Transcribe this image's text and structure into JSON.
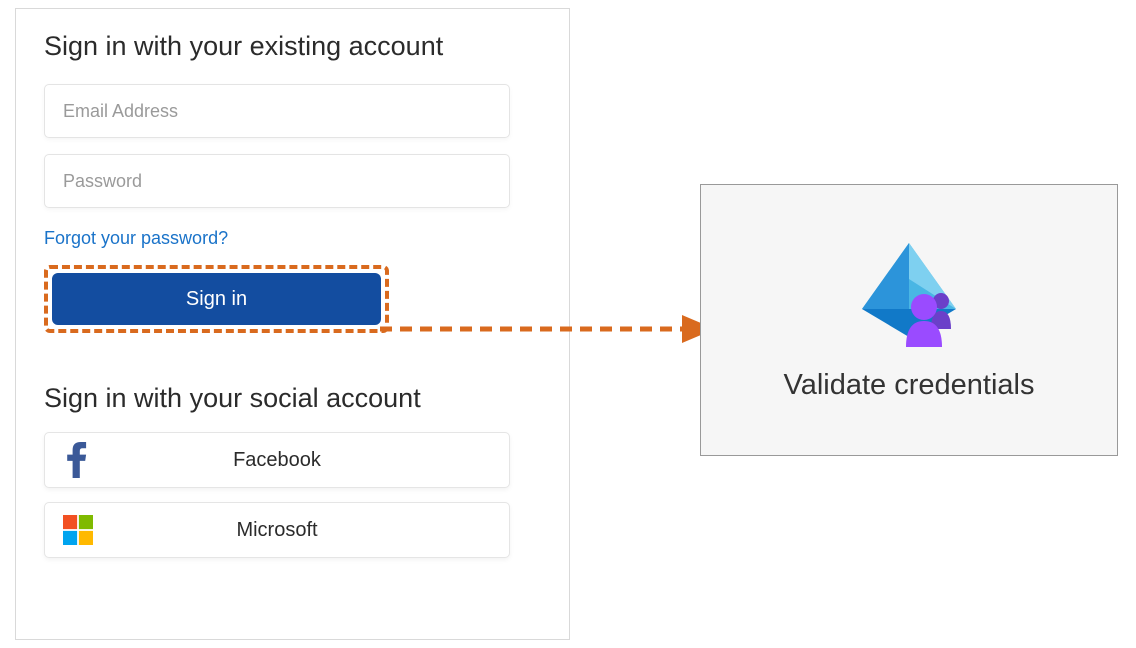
{
  "signin": {
    "existing_title": "Sign in with your existing account",
    "email_placeholder": "Email Address",
    "password_placeholder": "Password",
    "forgot_password": "Forgot your password?",
    "signin_button": "Sign in",
    "social_title": "Sign in with your social account",
    "facebook_label": "Facebook",
    "microsoft_label": "Microsoft"
  },
  "validate": {
    "label": "Validate credentials"
  },
  "colors": {
    "accent_orange": "#d96a1e",
    "primary_blue": "#134da0",
    "facebook_blue": "#3b5998",
    "link_blue": "#1a73c9"
  }
}
